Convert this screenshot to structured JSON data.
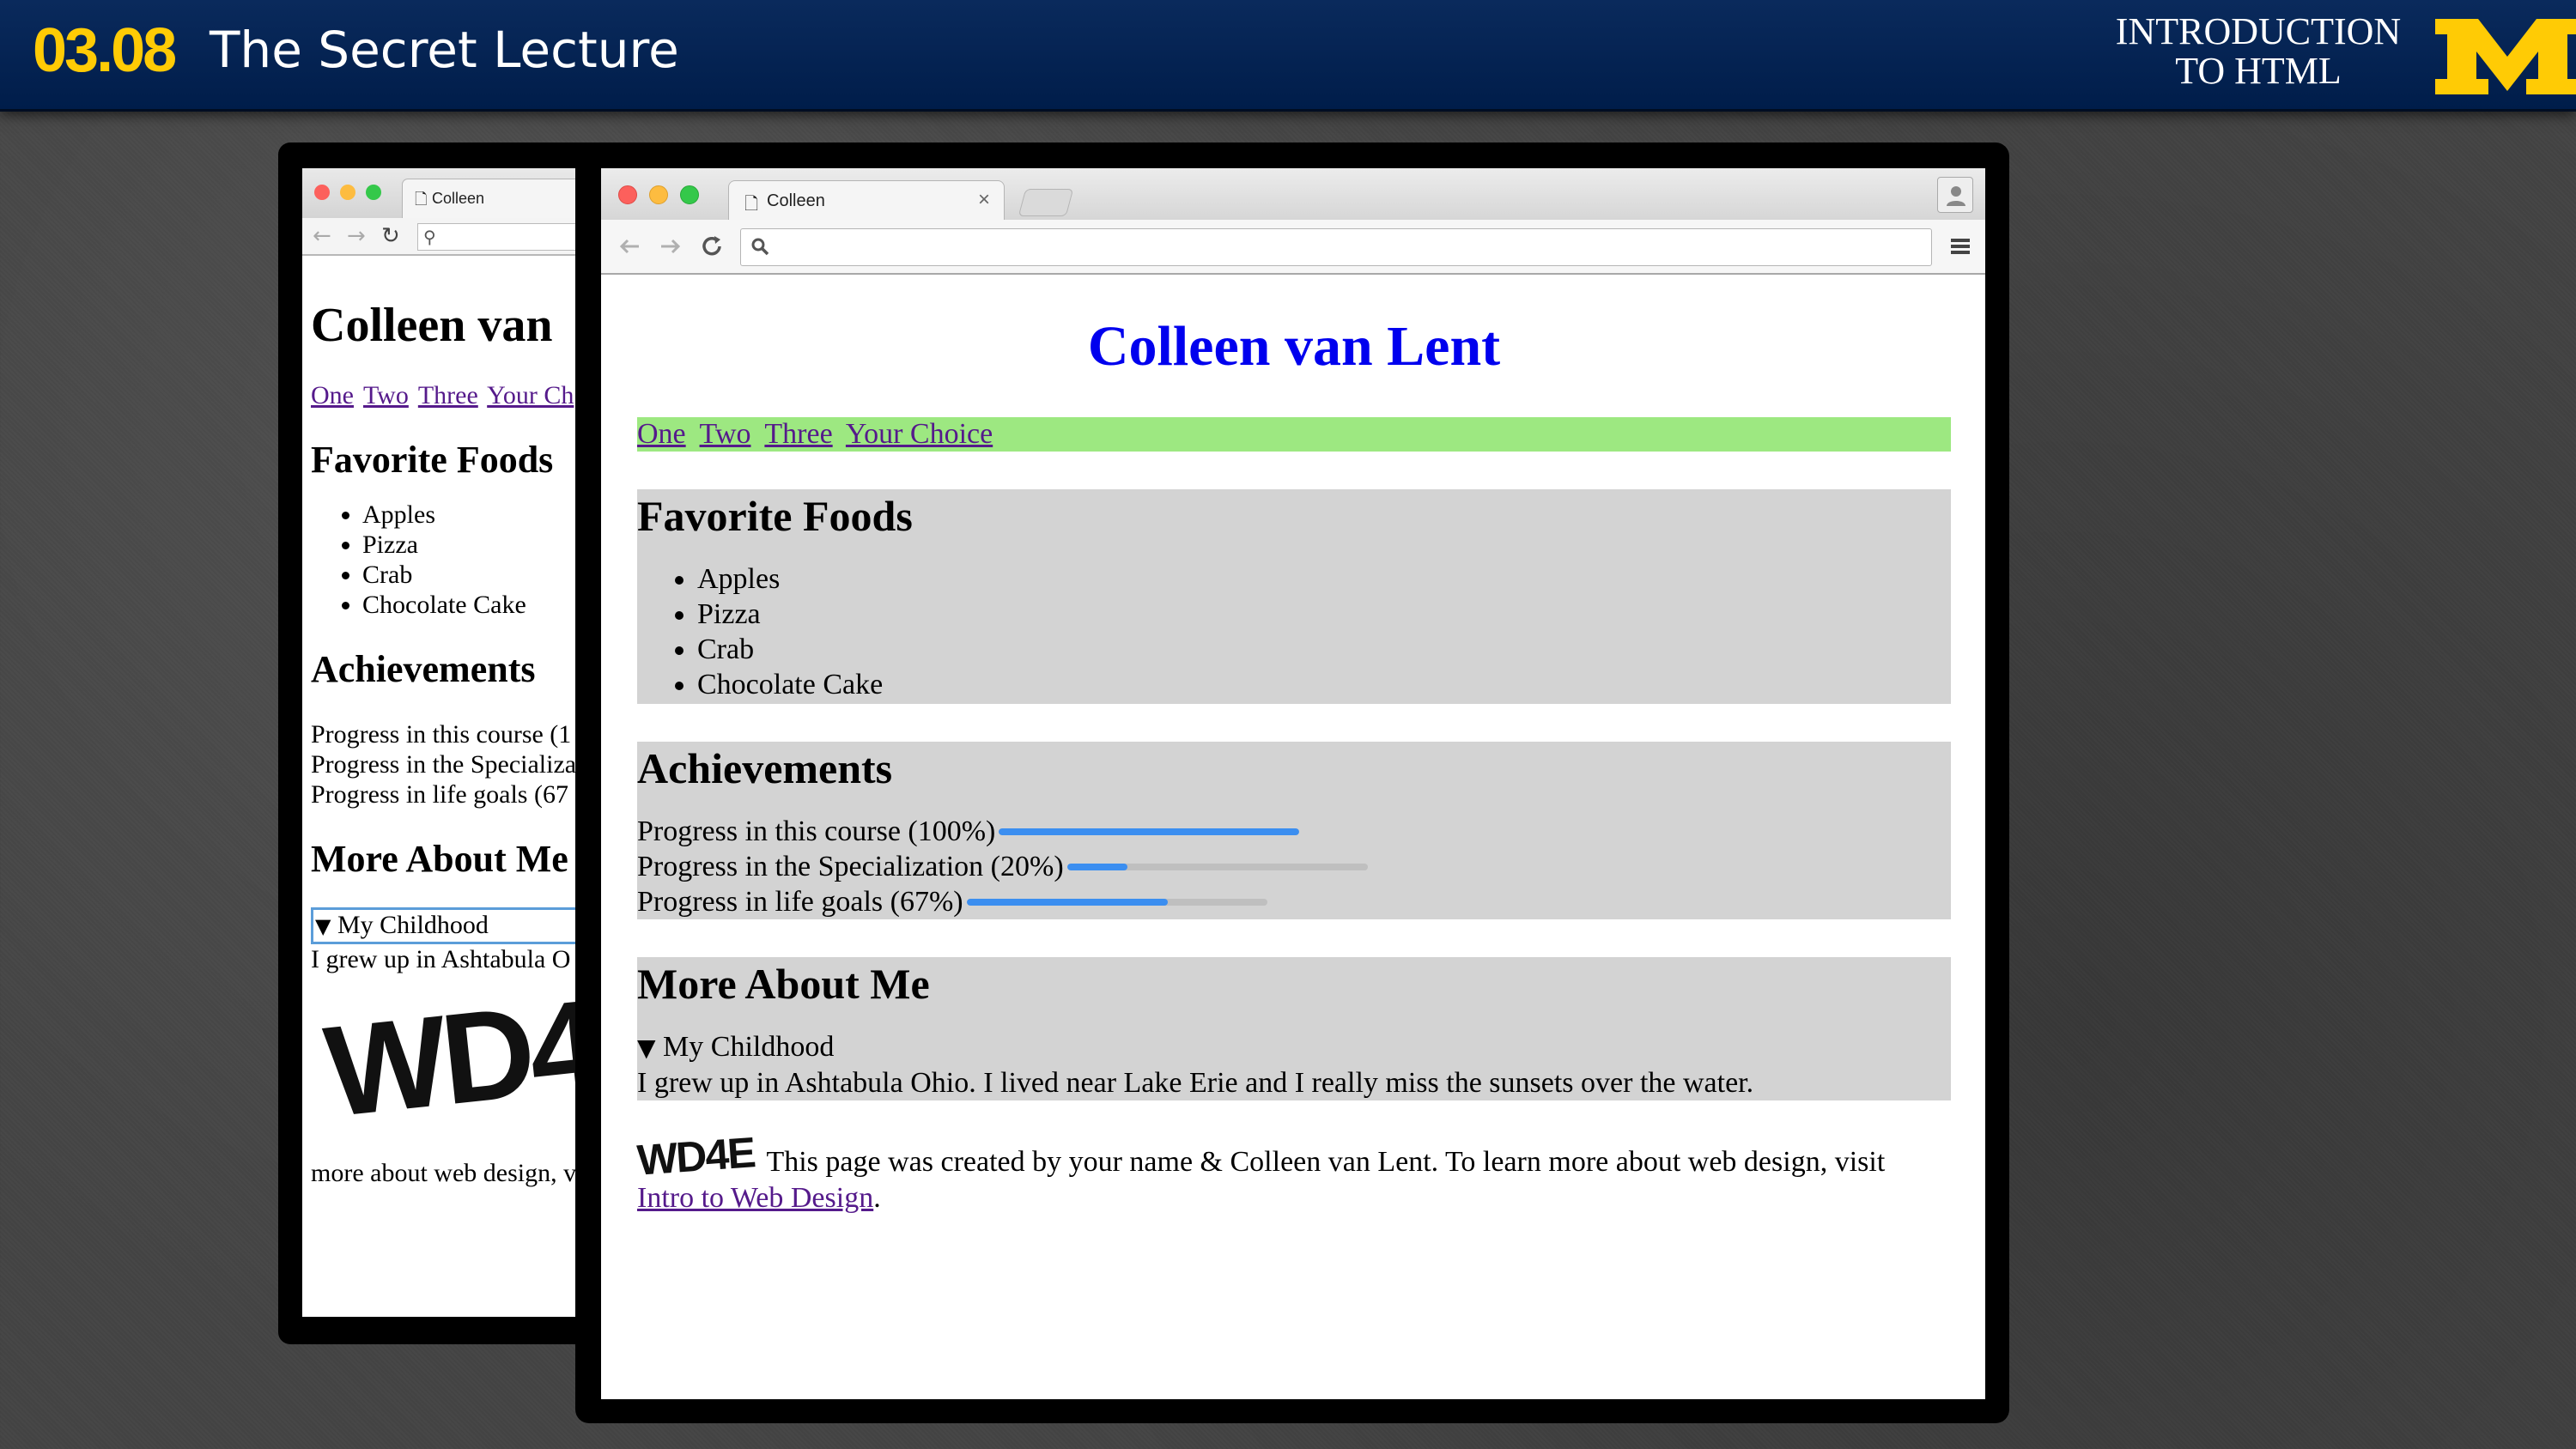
{
  "banner": {
    "lecture_number": "03.08",
    "lecture_title": "The Secret Lecture",
    "course_line1": "INTRODUCTION",
    "course_line2": "TO HTML",
    "brand_colors": {
      "navy": "#00274c",
      "maize": "#ffcb05"
    }
  },
  "browser": {
    "tab_title": "Colleen",
    "icons": [
      "page-icon",
      "close-icon",
      "back-icon",
      "forward-icon",
      "reload-icon",
      "search-icon",
      "menu-icon",
      "profile-icon"
    ]
  },
  "page": {
    "heading": "Colleen van Lent",
    "nav_links": [
      "One",
      "Two",
      "Three",
      "Your Choice"
    ],
    "foods": {
      "heading": "Favorite Foods",
      "items": [
        "Apples",
        "Pizza",
        "Crab",
        "Chocolate Cake"
      ]
    },
    "achievements": {
      "heading": "Achievements",
      "rows": [
        {
          "label": "Progress in this course (100%)",
          "value": 1.0
        },
        {
          "label": "Progress in the Specialization (20%)",
          "value": 0.2
        },
        {
          "label": "Progress in life goals (67%)",
          "value": 0.67
        }
      ]
    },
    "about": {
      "heading": "More About Me",
      "summary": "My Childhood",
      "text": "I grew up in Ashtabula Ohio. I lived near Lake Erie and I really miss the sunsets over the water."
    },
    "footer": {
      "logo_text": "WD4E",
      "text": "This page was created by your name & Colleen van Lent. To learn more about web design, visit",
      "link": "Intro to Web Design",
      "end": "."
    },
    "colors": {
      "heading": "#0000ee",
      "nav_background": "#9de881",
      "section_background": "#d3d3d3",
      "link_visited": "#551a8b",
      "progress_fill": "#3b8ef0"
    }
  },
  "back_browser": {
    "tab_title": "Colleen",
    "heading": "Colleen van",
    "nav_links": [
      "One",
      "Two",
      "Three",
      "Your Ch"
    ],
    "foods_heading": "Favorite Foods",
    "foods": [
      "Apples",
      "Pizza",
      "Crab",
      "Chocolate Cake"
    ],
    "achievements_heading": "Achievements",
    "progress": [
      "Progress in this course (1",
      "Progress in the Specializa",
      "Progress in life goals (67"
    ],
    "about_heading": "More About Me",
    "summary": "My Childhood",
    "about_text": "I grew up in Ashtabula O",
    "logo_text": "WD4",
    "footer_text": "more about web design, v"
  }
}
